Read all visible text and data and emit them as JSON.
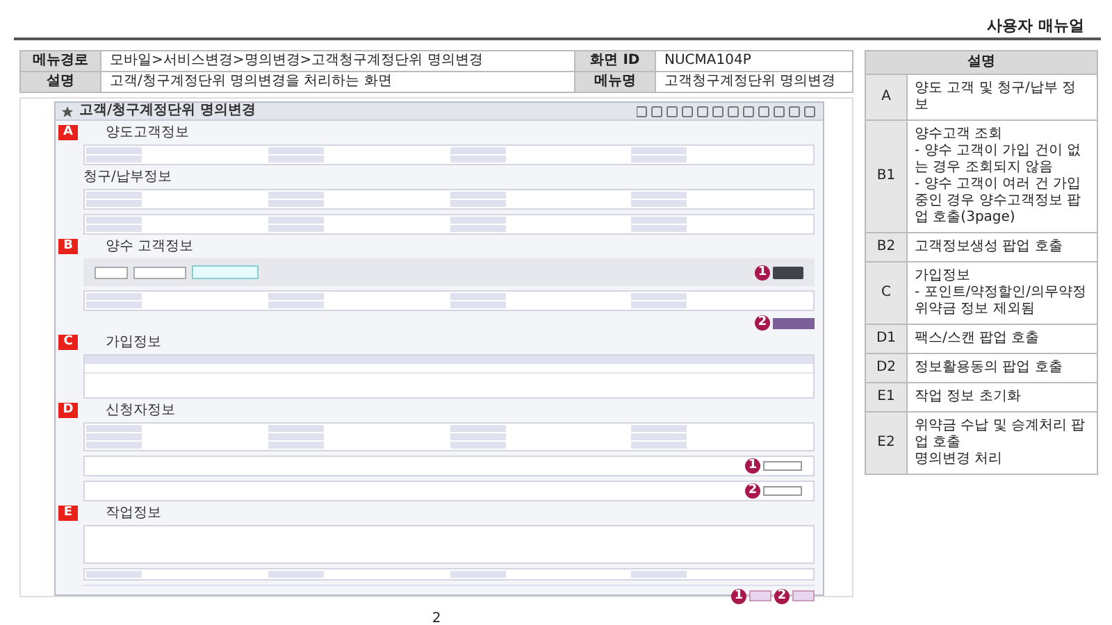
{
  "header": {
    "title": "사용자 매뉴얼"
  },
  "info": [
    {
      "label": "메뉴경로",
      "value": "모바일>서비스변경>명의변경>고객청구계정단위 명의변경",
      "label2": "화면 ID",
      "value2": "NUCMA104P"
    },
    {
      "label": "설명",
      "value": "고객/청구계정단위 명의변경을 처리하는 화면",
      "label2": "메뉴명",
      "value2": "고객청구계정단위 명의변경"
    }
  ],
  "screen": {
    "title": "고객/청구계정단위 명의변경",
    "blocks": [
      {
        "kind": "title",
        "marker": "A",
        "text": "양도고객정보"
      },
      {
        "kind": "form2"
      },
      {
        "kind": "title",
        "text": "청구/납부정보"
      },
      {
        "kind": "form2"
      },
      {
        "kind": "form2"
      },
      {
        "kind": "title",
        "marker": "B",
        "text": "양수 고객정보"
      },
      {
        "kind": "search",
        "callouts": [
          "1"
        ]
      },
      {
        "kind": "form2"
      },
      {
        "kind": "action",
        "callouts": [
          "2"
        ]
      },
      {
        "kind": "title",
        "marker": "C",
        "text": "가입정보"
      },
      {
        "kind": "table"
      },
      {
        "kind": "title",
        "marker": "D",
        "text": "신청자정보"
      },
      {
        "kind": "form3"
      },
      {
        "kind": "bar",
        "callouts": [
          "1"
        ]
      },
      {
        "kind": "bar",
        "callouts": [
          "2"
        ]
      },
      {
        "kind": "title",
        "marker": "E",
        "text": "작업정보"
      },
      {
        "kind": "memo"
      },
      {
        "kind": "form1"
      },
      {
        "kind": "footer",
        "callouts": [
          "1",
          "2"
        ]
      }
    ]
  },
  "legend": {
    "heading": "설명",
    "rows": [
      {
        "code": "A",
        "text": "양도 고객 및 청구/납부 정보"
      },
      {
        "code": "B1",
        "text": "양수고객 조회\n- 양수 고객이 가입 건이 없는 경우 조회되지 않음\n- 양수 고객이 여러 건 가입중인 경우 양수고객정보 팝업 호출(3page)"
      },
      {
        "code": "B2",
        "text": "고객정보생성 팝업 호출"
      },
      {
        "code": "C",
        "text": "가입정보\n- 포인트/약정할인/의무약정 위약금 정보 제외됨"
      },
      {
        "code": "D1",
        "text": "팩스/스캔 팝업 호출"
      },
      {
        "code": "D2",
        "text": "정보활용동의 팝업 호출"
      },
      {
        "code": "E1",
        "text": "작업 정보 초기화"
      },
      {
        "code": "E2",
        "text": "위약금 수납 및 승계처리 팝업 호출\n명의변경 처리"
      }
    ]
  },
  "page_number": "2"
}
